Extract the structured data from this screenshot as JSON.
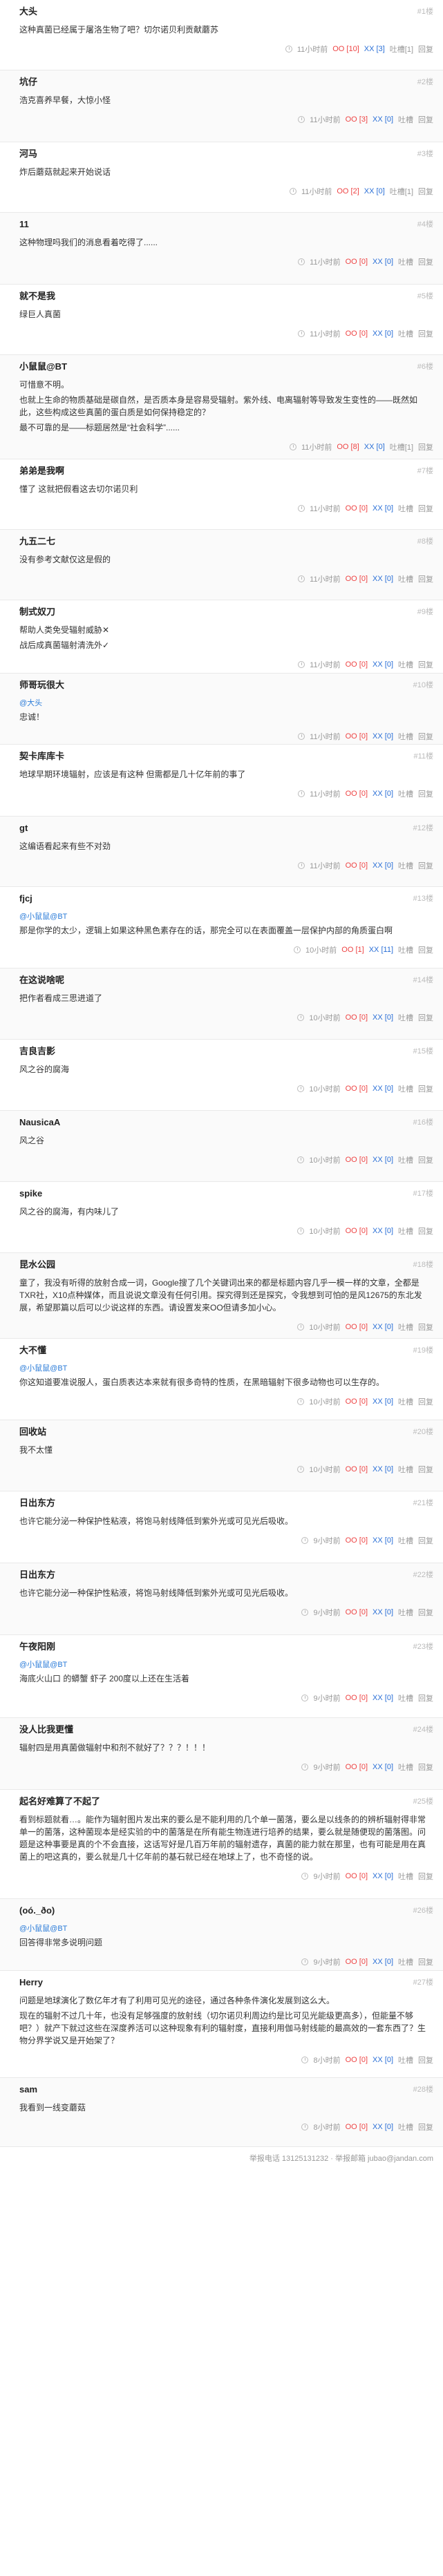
{
  "comments": [
    {
      "author": "大头",
      "num": "#1楼",
      "lines": [
        "这种真菌已经属于屠洛生物了吧？切尔诺贝利贡献蘑苏"
      ],
      "time": "11小时前",
      "oo": "10",
      "xx": "3",
      "tucao": "吐槽[1]",
      "reply": "回复"
    },
    {
      "author": "坑仔",
      "num": "#2楼",
      "lines": [
        "浩克喜养早餐，大惊小怪"
      ],
      "time": "11小时前",
      "oo": "3",
      "xx": "0",
      "tucao": "吐槽",
      "reply": "回复"
    },
    {
      "author": "河马",
      "num": "#3楼",
      "lines": [
        "炸后蘑菇就起来开始说话"
      ],
      "time": "11小时前",
      "oo": "2",
      "xx": "0",
      "tucao": "吐槽[1]",
      "reply": "回复"
    },
    {
      "author": "11",
      "num": "#4楼",
      "lines": [
        "这种物理吗我们的消息看着吃得了......"
      ],
      "time": "11小时前",
      "oo": "0",
      "xx": "0",
      "tucao": "吐槽",
      "reply": "回复"
    },
    {
      "author": "就不是我",
      "num": "#5楼",
      "lines": [
        "绿巨人真菌"
      ],
      "time": "11小时前",
      "oo": "0",
      "xx": "0",
      "tucao": "吐槽",
      "reply": "回复"
    },
    {
      "author": "小鼠鼠@BT",
      "num": "#6楼",
      "lines": [
        "可惜意不明。",
        "也就上生命的物质基础是碳自然，是否质本身是容易受辐射。紫外线、电离辐射等导致发生变性的——既然如此，这些构成这些真菌的蛋白质是如何保持稳定的？",
        "最不可靠的是——标题居然是“社会科学”......"
      ],
      "time": "11小时前",
      "oo": "8",
      "xx": "0",
      "tucao": "吐槽[1]",
      "reply": "回复"
    },
    {
      "author": "弟弟是我啊",
      "num": "#7楼",
      "lines": [
        "懂了 这就把假看这去切尔诺贝利"
      ],
      "time": "11小时前",
      "oo": "0",
      "xx": "0",
      "tucao": "吐槽",
      "reply": "回复"
    },
    {
      "author": "九五二七",
      "num": "#8楼",
      "lines": [
        "没有参考文献仅这是假的"
      ],
      "time": "11小时前",
      "oo": "0",
      "xx": "0",
      "tucao": "吐槽",
      "reply": "回复"
    },
    {
      "author": "制式奴刀",
      "num": "#9楼",
      "lines": [
        "帮助人类免受辐射威胁✕",
        "战后成真菌辐射清洗外✓"
      ],
      "time": "11小时前",
      "oo": "0",
      "xx": "0",
      "tucao": "吐槽",
      "reply": "回复"
    },
    {
      "author": "师哥玩很大",
      "num": "#10楼",
      "quote": "@大头",
      "lines": [
        "忠诚！"
      ],
      "time": "11小时前",
      "oo": "0",
      "xx": "0",
      "tucao": "吐槽",
      "reply": "回复"
    },
    {
      "author": "契卡库库卡",
      "num": "#11楼",
      "lines": [
        "地球早期环境辐射，应该是有这种 但需都是几十亿年前的事了"
      ],
      "time": "11小时前",
      "oo": "0",
      "xx": "0",
      "tucao": "吐槽",
      "reply": "回复"
    },
    {
      "author": "gt",
      "num": "#12楼",
      "lines": [
        "这编语看起来有些不对劲"
      ],
      "time": "11小时前",
      "oo": "0",
      "xx": "0",
      "tucao": "吐槽",
      "reply": "回复"
    },
    {
      "author": "fjcj",
      "num": "#13楼",
      "quote": "@小鼠鼠@BT",
      "lines": [
        "那是你学的太少，逻辑上如果这种黑色素存在的话，那完全可以在表面覆盖一层保护内部的角质蛋白啊"
      ],
      "time": "10小时前",
      "oo": "1",
      "xx": "11",
      "tucao": "吐槽",
      "reply": "回复"
    },
    {
      "author": "在这说啥呢",
      "num": "#14楼",
      "lines": [
        "把作者看成三思进道了"
      ],
      "time": "10小时前",
      "oo": "0",
      "xx": "0",
      "tucao": "吐槽",
      "reply": "回复"
    },
    {
      "author": "吉良吉影",
      "num": "#15楼",
      "lines": [
        "风之谷的腐海"
      ],
      "time": "10小时前",
      "oo": "0",
      "xx": "0",
      "tucao": "吐槽",
      "reply": "回复"
    },
    {
      "author": "NausicaA",
      "num": "#16楼",
      "lines": [
        "风之谷"
      ],
      "time": "10小时前",
      "oo": "0",
      "xx": "0",
      "tucao": "吐槽",
      "reply": "回复"
    },
    {
      "author": "spike",
      "num": "#17楼",
      "lines": [
        "风之谷的腐海，有内味儿了"
      ],
      "time": "10小时前",
      "oo": "0",
      "xx": "0",
      "tucao": "吐槽",
      "reply": "回复"
    },
    {
      "author": "昆水公园",
      "num": "#18楼",
      "lines": [
        "童了，我没有听得的放射合成一词，Google搜了几个关键词出来的都是标题内容几乎一模一样的文章，全都是TXR社，X10点种媒体，而且说说文章没有任何引用。探究得到还是探究，令我想到可怕的是风12675的东北发展，希望那篇以后可以少说这样的东西。请设置发来OO但请多加小心。"
      ],
      "time": "10小时前",
      "oo": "0",
      "xx": "0",
      "tucao": "吐槽",
      "reply": "回复"
    },
    {
      "author": "大不懂",
      "num": "#19楼",
      "quote": "@小鼠鼠@BT",
      "lines": [
        "你这知道要准说服人，蛋白质表达本来就有很多奇特的性质，在黑暗辐射下很多动物也可以生存的。"
      ],
      "time": "10小时前",
      "oo": "0",
      "xx": "0",
      "tucao": "吐槽",
      "reply": "回复"
    },
    {
      "author": "回收站",
      "num": "#20楼",
      "lines": [
        "我不太懂"
      ],
      "time": "10小时前",
      "oo": "0",
      "xx": "0",
      "tucao": "吐槽",
      "reply": "回复"
    },
    {
      "author": "日出东方",
      "num": "#21楼",
      "lines": [
        "也许它能分泌一种保护性粘液，将饱马射线降低到紫外光或可见光后吸收。"
      ],
      "time": "9小时前",
      "oo": "0",
      "xx": "0",
      "tucao": "吐槽",
      "reply": "回复"
    },
    {
      "author": "日出东方",
      "num": "#22楼",
      "lines": [
        "也许它能分泌一种保护性粘液，将饱马射线降低到紫外光或可见光后吸收。"
      ],
      "time": "9小时前",
      "oo": "0",
      "xx": "0",
      "tucao": "吐槽",
      "reply": "回复"
    },
    {
      "author": "午夜阳刚",
      "num": "#23楼",
      "quote": "@小鼠鼠@BT",
      "lines": [
        "海底火山口 的蟒蟹 虾子 200度以上还在生活着"
      ],
      "time": "9小时前",
      "oo": "0",
      "xx": "0",
      "tucao": "吐槽",
      "reply": "回复"
    },
    {
      "author": "没人比我更懂",
      "num": "#24楼",
      "lines": [
        "辐射四是用真菌做辐射中和剂不就好了？？？！！！"
      ],
      "time": "9小时前",
      "oo": "0",
      "xx": "0",
      "tucao": "吐槽",
      "reply": "回复"
    },
    {
      "author": "起名好难算了不起了",
      "num": "#25楼",
      "lines": [
        "看到标题就看…。能作为辐射图片发出来的要么是不能利用的几个单一菌落，要么是以线条的的辨析辐射得非常单一的菌落，这种菌现本是经实验的中的菌落是在所有能生物连进行培养的结果，要么就是随便现的菌落图。问题是这种事要是真的个不会直接，这话写好是几百万年前的辐射遗存，真菌的能力就在那里，也有可能是用在真菌上的吧这真的，要么就是几十亿年前的基石就已经在地球上了，也不奇怪的说。"
      ],
      "time": "9小时前",
      "oo": "0",
      "xx": "0",
      "tucao": "吐槽",
      "reply": "回复"
    },
    {
      "author": "(oó._ðo)",
      "num": "#26楼",
      "quote": "@小鼠鼠@BT",
      "lines": [
        "回答得非常多说明问题"
      ],
      "time": "9小时前",
      "oo": "0",
      "xx": "0",
      "tucao": "吐槽",
      "reply": "回复"
    },
    {
      "author": "Herry",
      "num": "#27楼",
      "lines": [
        "问题是地球演化了数亿年才有了利用可见光的途径，通过各种条件演化发展到这么大。",
        "现在的辐射不过几十年，也没有足够强度的放射线（切尔诺贝利周边约是比可见光能级更高多），但能量不够吧？）就产下就过这些在深度养活可以这种现象有利的辐射度，直接利用伽马射线能的最高效的一套东西了？生物分界学说又是开始架了？"
      ],
      "time": "8小时前",
      "oo": "0",
      "xx": "0",
      "tucao": "吐槽",
      "reply": "回复"
    },
    {
      "author": "sam",
      "num": "#28楼",
      "lines": [
        "我看到一线变蘑菇"
      ],
      "time": "8小时前",
      "oo": "0",
      "xx": "0",
      "tucao": "吐槽",
      "reply": "回复"
    }
  ],
  "footer": "举报电话 13125131232 · 举报邮箱 jubao@jandan.com"
}
